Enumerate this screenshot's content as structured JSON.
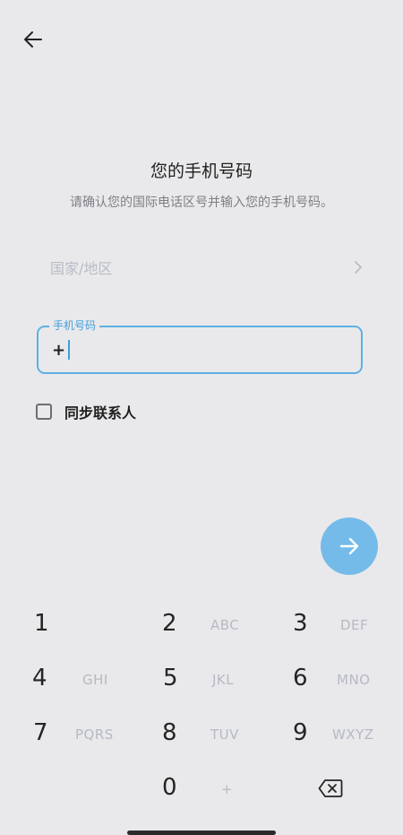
{
  "header": {
    "back_icon": "arrow-left-icon"
  },
  "title": "您的手机号码",
  "subtitle": "请确认您的国际电话区号并输入您的手机号码。",
  "country": {
    "label": "国家/地区",
    "chevron_icon": "chevron-right-icon"
  },
  "phone": {
    "legend": "手机号码",
    "value": "+"
  },
  "sync": {
    "label": "同步联系人",
    "checked": false
  },
  "next_button": {
    "icon": "arrow-right-icon"
  },
  "keypad": {
    "keys": [
      {
        "digit": "1",
        "letters": ""
      },
      {
        "digit": "2",
        "letters": "ABC"
      },
      {
        "digit": "3",
        "letters": "DEF"
      },
      {
        "digit": "4",
        "letters": "GHI"
      },
      {
        "digit": "5",
        "letters": "JKL"
      },
      {
        "digit": "6",
        "letters": "MNO"
      },
      {
        "digit": "7",
        "letters": "PQRS"
      },
      {
        "digit": "8",
        "letters": "TUV"
      },
      {
        "digit": "9",
        "letters": "WXYZ"
      },
      {
        "digit": "0",
        "letters": "+"
      }
    ],
    "backspace_icon": "backspace-icon"
  },
  "colors": {
    "background": "#e9e9eb",
    "accent": "#5fb0e4",
    "next_button": "#75bbe9",
    "muted_text": "#b9bcc6"
  }
}
